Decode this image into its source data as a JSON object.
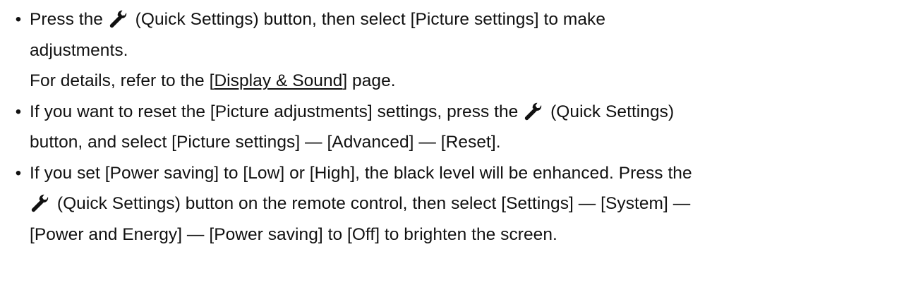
{
  "bullet_glyph": "•",
  "icons": {
    "quick_settings": "wrench-icon"
  },
  "bullets": [
    {
      "line1_before_icon": "Press the ",
      "line1_after_icon": " (Quick Settings) button, then select [Picture settings] to make",
      "line2": "adjustments.",
      "line3_before_link": "For details, refer to the [",
      "line3_link": "Display & Sound",
      "line3_after_link": "] page."
    },
    {
      "line1_before_icon": "If you want to reset the [Picture adjustments] settings, press the ",
      "line1_after_icon": " (Quick Settings)",
      "line2": "button, and select [Picture settings] — [Advanced] — [Reset]."
    },
    {
      "line1": "If you set [Power saving] to [Low] or [High], the black level will be enhanced. Press the",
      "line2_after_icon": " (Quick Settings) button on the remote control, then select [Settings] — [System] —",
      "line3": "[Power and Energy] — [Power saving] to [Off] to brighten the screen."
    }
  ]
}
